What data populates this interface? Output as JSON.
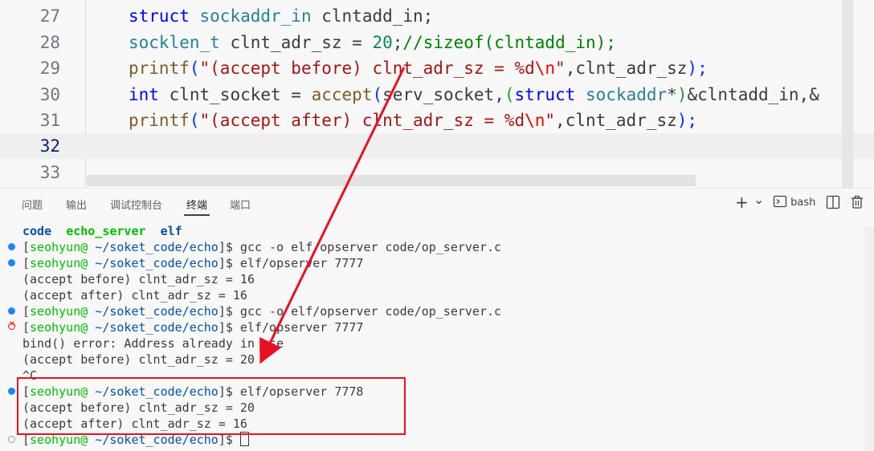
{
  "editor": {
    "lines": [
      {
        "num": "27"
      },
      {
        "num": "28"
      },
      {
        "num": "29"
      },
      {
        "num": "30"
      },
      {
        "num": "31"
      },
      {
        "num": "32"
      },
      {
        "num": "33"
      }
    ],
    "tokens": {
      "l27_kw": "struct",
      "l27_ty": "sockaddr_in",
      "l27_rest": "clntadd_in;",
      "l28_ty": "socklen_t",
      "l28_var": "clnt_adr_sz = ",
      "l28_num": "20",
      "l28_semi": ";",
      "l28_cm": "//sizeof(clntadd_in);",
      "l29_fn": "printf",
      "l29_open": "(",
      "l29_str": "\"(accept before) clnt_adr_sz = %d",
      "l29_esc": "\\n",
      "l29_strend": "\"",
      "l29_rest": ",clnt_adr_sz",
      "l29_close": ");",
      "l30_kw": "int",
      "l30_var": "clnt_socket = ",
      "l30_fn": "accept",
      "l30_open": "(",
      "l30_a": "serv_socket,",
      "l30_open2": "(",
      "l30_kw2": "struct",
      "l30_ty2": "sockaddr",
      "l30_star": "*",
      "l30_close2": ")",
      "l30_rest": "&clntadd_in,&",
      "l31_fn": "printf",
      "l31_open": "(",
      "l31_str": "\"(accept after) clnt_adr_sz = %d",
      "l31_esc": "\\n",
      "l31_strend": "\"",
      "l31_rest": ",clnt_adr_sz",
      "l31_close": ");"
    }
  },
  "panel": {
    "tabs": [
      "问题",
      "输出",
      "调试控制台",
      "终端",
      "端口"
    ],
    "active_tab": "终端",
    "toolbar": {
      "add_icon": "+",
      "dropdown_icon": "⌄",
      "shell_label": "bash",
      "split_icon": "split-icon",
      "trash_icon": "trash-icon"
    }
  },
  "terminal": {
    "ls_output": {
      "d1": "code",
      "d2": "echo_server",
      "d3": "elf"
    },
    "user": "seohyun",
    "at": "@",
    "path": " ~/soket_code/echo",
    "prompt_open": "[",
    "prompt_close": "]$",
    "cmd1": " gcc -o elf/opserver code/op_server.c",
    "cmd2": " elf/opserver 7777",
    "out1": "(accept before) clnt_adr_sz = 16",
    "out2": "(accept after) clnt_adr_sz = 16",
    "cmd3": " gcc -o elf/opserver code/op_server.c",
    "cmd4": " elf/opserver 7777",
    "out3": "bind() error: Address already in use",
    "out4": "(accept before) clnt_adr_sz = 20",
    "out5": "^C",
    "cmd5": " elf/opserver 7778",
    "out6": "(accept before) clnt_adr_sz = 20",
    "out7": "(accept after) clnt_adr_sz = 16"
  },
  "colors": {
    "annotation_red": "#e81123",
    "prompt_green": "#00bc00",
    "path_blue": "#0451a5"
  }
}
